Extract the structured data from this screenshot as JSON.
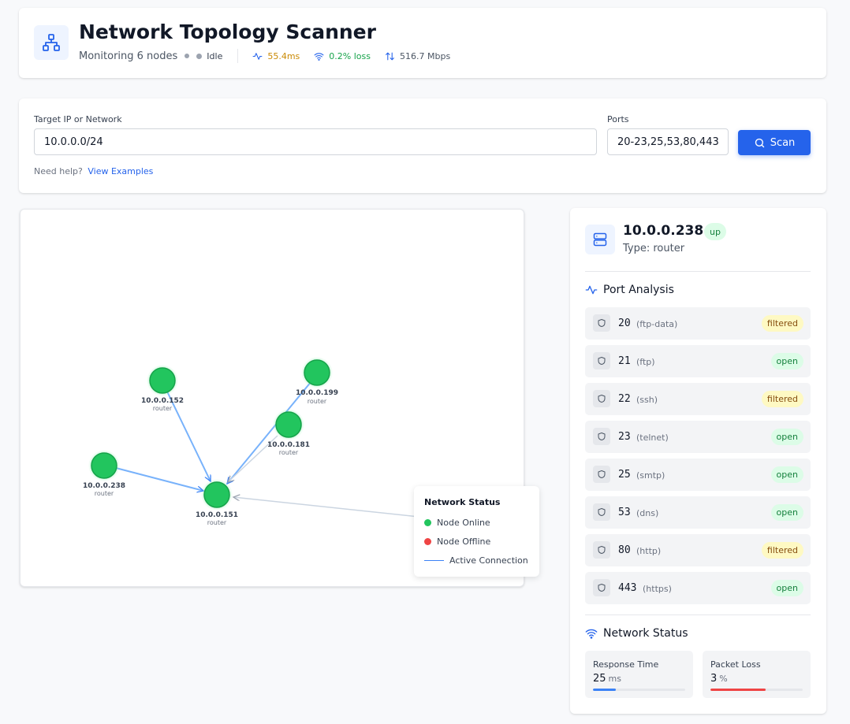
{
  "header": {
    "title": "Network Topology Scanner",
    "monitoring": "Monitoring 6 nodes",
    "state": "Idle",
    "latency": "55.4ms",
    "loss": "0.2% loss",
    "throughput": "516.7 Mbps",
    "colors": {
      "latency": "#ca8a04",
      "loss": "#16a34a",
      "throughput": "#4b5563"
    }
  },
  "scan_form": {
    "target_label": "Target IP or Network",
    "target_value": "10.0.0.0/24",
    "ports_label": "Ports",
    "ports_value": "20-23,25,53,80,443",
    "scan_button": "Scan",
    "help_text": "Need help?",
    "help_link": "View Examples"
  },
  "topology": {
    "nodes": [
      {
        "ip": "10.0.0.152",
        "type": "router",
        "status": "online"
      },
      {
        "ip": "10.0.0.199",
        "type": "router",
        "status": "online"
      },
      {
        "ip": "10.0.0.181",
        "type": "router",
        "status": "online"
      },
      {
        "ip": "10.0.0.238",
        "type": "router",
        "status": "online"
      },
      {
        "ip": "10.0.0.151",
        "type": "router",
        "status": "online"
      }
    ],
    "legend": {
      "title": "Network Status",
      "online": "Node Online",
      "offline": "Node Offline",
      "connection": "Active Connection",
      "colors": {
        "online": "#22c55e",
        "offline": "#ef4444",
        "connection": "#3b82f6"
      }
    }
  },
  "details": {
    "ip": "10.0.0.238",
    "state": "up",
    "type": "Type: router",
    "port_analysis_title": "Port Analysis",
    "ports": [
      {
        "port": "20",
        "service": "(ftp-data)",
        "status": "filtered"
      },
      {
        "port": "21",
        "service": "(ftp)",
        "status": "open"
      },
      {
        "port": "22",
        "service": "(ssh)",
        "status": "filtered"
      },
      {
        "port": "23",
        "service": "(telnet)",
        "status": "open"
      },
      {
        "port": "25",
        "service": "(smtp)",
        "status": "open"
      },
      {
        "port": "53",
        "service": "(dns)",
        "status": "open"
      },
      {
        "port": "80",
        "service": "(http)",
        "status": "filtered"
      },
      {
        "port": "443",
        "service": "(https)",
        "status": "open"
      }
    ],
    "network_status_title": "Network Status",
    "response_time": {
      "label": "Response Time",
      "value": "25",
      "unit": "ms",
      "fraction": 0.25,
      "color": "#3b82f6"
    },
    "packet_loss": {
      "label": "Packet Loss",
      "value": "3",
      "unit": "%",
      "fraction": 0.6,
      "color": "#ef4444"
    }
  }
}
